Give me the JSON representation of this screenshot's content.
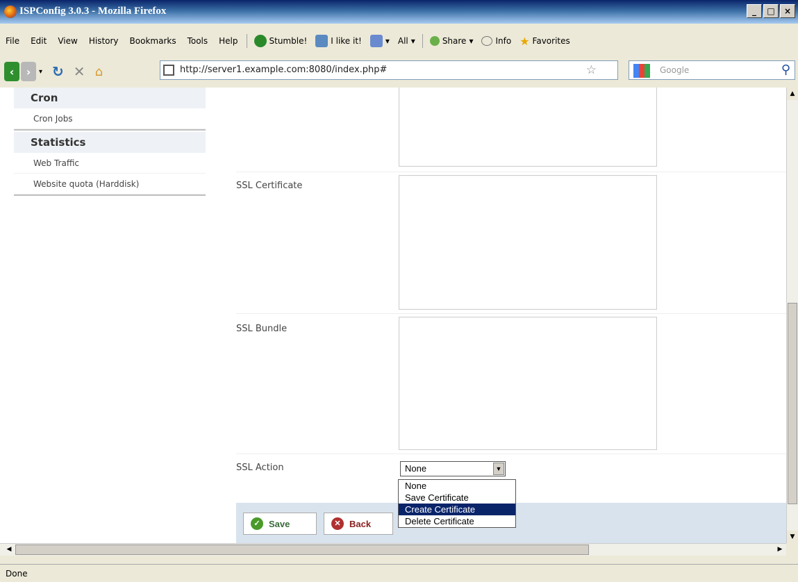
{
  "window": {
    "title": "ISPConfig 3.0.3 - Mozilla Firefox",
    "controls": [
      "_",
      "□",
      "×"
    ]
  },
  "menubar": {
    "items": [
      "File",
      "Edit",
      "View",
      "History",
      "Bookmarks",
      "Tools",
      "Help"
    ],
    "toolbar": {
      "stumble": "Stumble!",
      "ilike": "I like it!",
      "all": "All",
      "share": "Share",
      "info": "Info",
      "favorites": "Favorites"
    }
  },
  "navbar": {
    "url": "http://server1.example.com:8080/index.php#",
    "search_placeholder": "Google"
  },
  "sidebar": {
    "sections": [
      {
        "heading": "Cron",
        "links": [
          "Cron Jobs"
        ]
      },
      {
        "heading": "Statistics",
        "links": [
          "Web Traffic",
          "Website quota (Harddisk)"
        ]
      }
    ]
  },
  "form": {
    "ssl_certificate_label": "SSL Certificate",
    "ssl_bundle_label": "SSL Bundle",
    "ssl_action_label": "SSL Action",
    "ssl_action_value": "None",
    "ssl_action_options": [
      "None",
      "Save Certificate",
      "Create Certificate",
      "Delete Certificate"
    ],
    "ssl_action_highlighted": "Create Certificate",
    "save_label": "Save",
    "back_label": "Back"
  },
  "statusbar": {
    "text": "Done"
  },
  "colors": {
    "titlebar": "#0a246a",
    "sidebar_heading_bg": "#eef1f5",
    "button_bar_bg": "#d8e3ee",
    "highlight": "#0a246a"
  }
}
